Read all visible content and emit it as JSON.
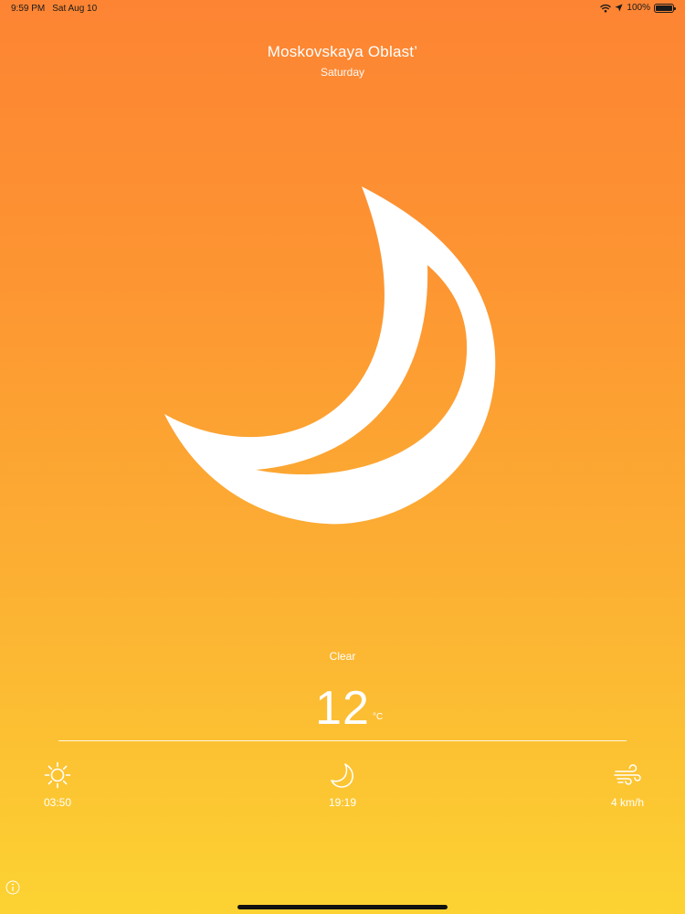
{
  "status_bar": {
    "time": "9:59 PM",
    "date": "Sat Aug 10",
    "battery": "100%",
    "icons": [
      "wifi-icon",
      "location-arrow-icon",
      "battery-icon"
    ]
  },
  "weather": {
    "location": "Moskovskaya Oblast’",
    "day": "Saturday",
    "main_icon": "crescent-moon-icon",
    "condition": "Clear",
    "temperature": "12",
    "unit": "°C"
  },
  "stats": {
    "sunrise": {
      "icon": "sun-icon",
      "value": "03:50"
    },
    "sunset": {
      "icon": "moon-icon",
      "value": "19:19"
    },
    "wind": {
      "icon": "wind-icon",
      "value": "4 km/h"
    }
  },
  "colors": {
    "gradient_top": "#fd8433",
    "gradient_bottom": "#fcd332",
    "foreground": "#ffffff"
  }
}
